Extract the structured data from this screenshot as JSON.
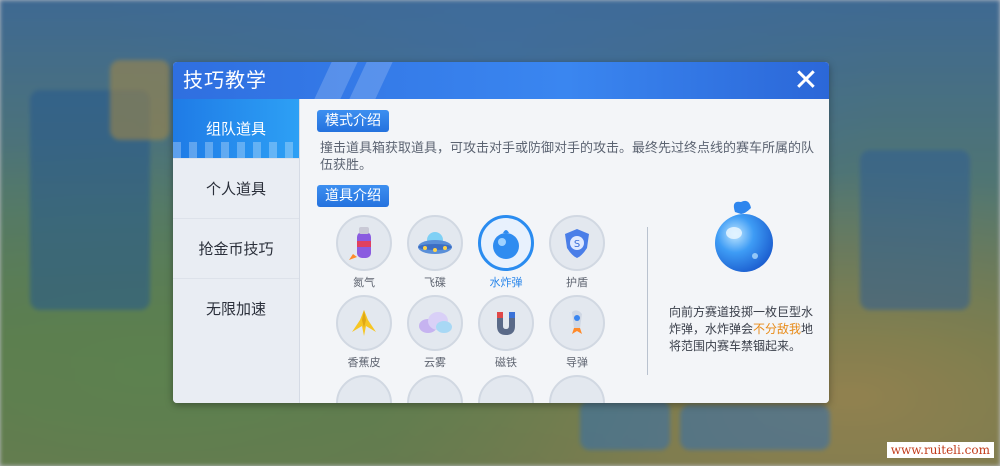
{
  "window": {
    "title": "技巧教学",
    "close_symbol": "✕"
  },
  "tabs": [
    {
      "label": "组队道具",
      "active": true
    },
    {
      "label": "个人道具",
      "active": false
    },
    {
      "label": "抢金币技巧",
      "active": false
    },
    {
      "label": "无限加速",
      "active": false
    }
  ],
  "mode_section": {
    "title": "模式介绍",
    "description": "撞击道具箱获取道具，可攻击对手或防御对手的攻击。最终先过终点线的赛车所属的队伍获胜。"
  },
  "items_section": {
    "title": "道具介绍",
    "items": [
      {
        "label": "氮气",
        "icon": "nitro-bottle-icon",
        "selected": false
      },
      {
        "label": "飞碟",
        "icon": "ufo-icon",
        "selected": false
      },
      {
        "label": "水炸弹",
        "icon": "water-bomb-icon",
        "selected": true
      },
      {
        "label": "护盾",
        "icon": "shield-icon",
        "selected": false
      },
      {
        "label": "香蕉皮",
        "icon": "banana-peel-icon",
        "selected": false
      },
      {
        "label": "云雾",
        "icon": "cloud-icon",
        "selected": false
      },
      {
        "label": "磁铁",
        "icon": "magnet-icon",
        "selected": false
      },
      {
        "label": "导弹",
        "icon": "missile-icon",
        "selected": false
      }
    ]
  },
  "detail": {
    "icon": "water-bomb-icon",
    "text_before": "向前方赛道投掷一枚巨型水炸弹，水炸弹会",
    "text_highlight": "不分敌我",
    "text_after": "地将范围内赛车禁锢起来。",
    "highlight_color": "#e88b18"
  },
  "accent_color": "#2a8cf0",
  "watermark": "www.ruiteli.com"
}
